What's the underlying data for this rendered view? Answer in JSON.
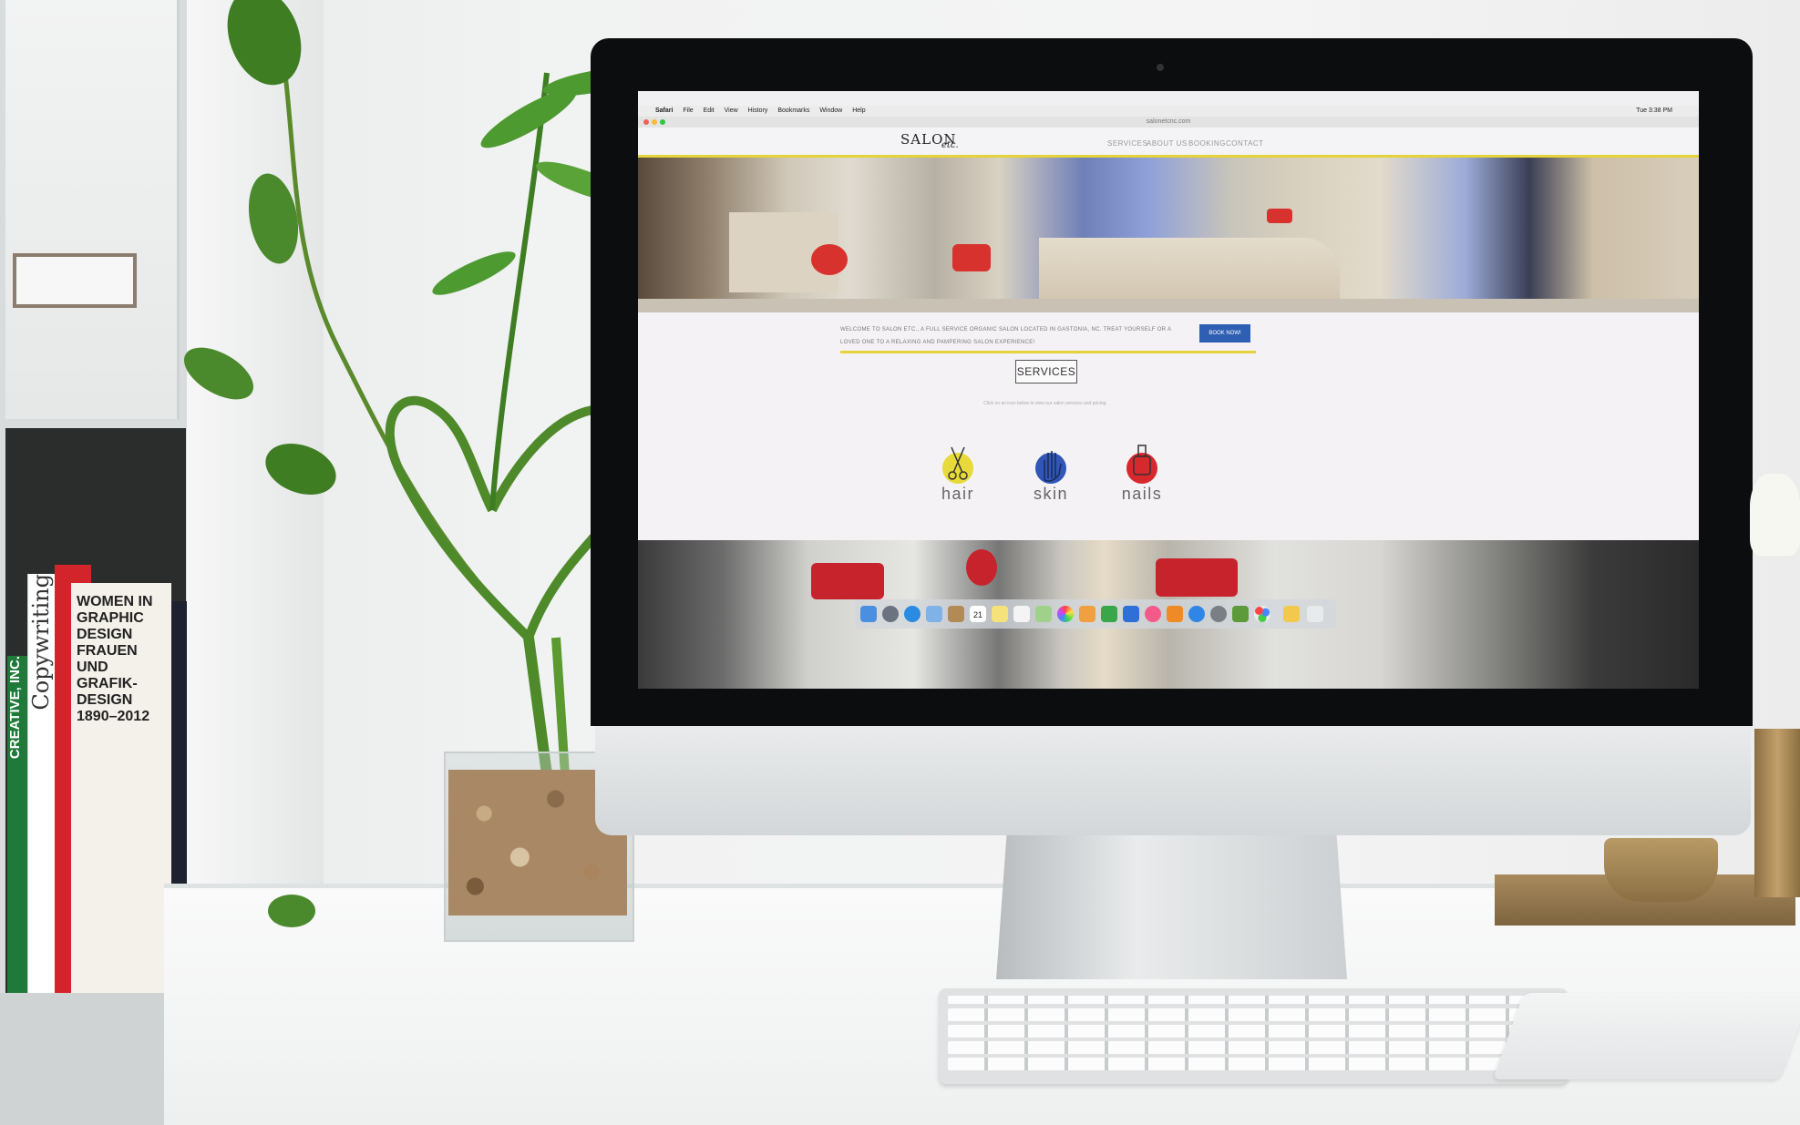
{
  "browser": {
    "menu": [
      "Safari",
      "File",
      "Edit",
      "View",
      "History",
      "Bookmarks",
      "Window",
      "Help"
    ],
    "url": "salonetcnc.com",
    "clock": "Tue 3:38 PM"
  },
  "site": {
    "logo": "SALON",
    "logo_suffix": "etc.",
    "nav": [
      "SERVICES",
      "ABOUT US",
      "BOOKING",
      "CONTACT"
    ],
    "welcome": "WELCOME TO SALON ETC., A FULL SERVICE ORGANIC SALON LOCATED IN GASTONIA, NC. TREAT YOURSELF OR A LOVED ONE TO A RELAXING AND PAMPERING SALON EXPERIENCE!",
    "book_button": "BOOK NOW!",
    "services_title": "SERVICES",
    "services_hint": "Click on an icon below to view our salon services and pricing.",
    "services": [
      {
        "label": "hair",
        "icon": "scissors-icon",
        "color": "#e7da3a"
      },
      {
        "label": "skin",
        "icon": "hand-icon",
        "color": "#3156b8"
      },
      {
        "label": "nails",
        "icon": "nail-polish-icon",
        "color": "#d7282d"
      }
    ]
  },
  "dock": {
    "calendar_day": "21",
    "icons": [
      "finder-icon",
      "launchpad-icon",
      "safari-icon",
      "mail-icon",
      "contacts-icon",
      "calendar-icon",
      "notes-icon",
      "reminders-icon",
      "maps-icon",
      "photos-icon",
      "pages-icon",
      "numbers-icon",
      "keynote-icon",
      "itunes-icon",
      "ibooks-icon",
      "app-store-icon",
      "system-preferences-icon",
      "minecraft-icon",
      "game-center-icon",
      "folder-icon",
      "trash-icon"
    ]
  },
  "books": [
    {
      "title": "CREATIVE, INC.",
      "color": "#1f7a3a"
    },
    {
      "title": "Copywriting",
      "color": "#ffffff"
    },
    {
      "title": "WOMEN IN GRAPHIC DESIGN FRAUEN UND GRAFIK-DESIGN 1890–2012",
      "color": "#f4f1ea"
    }
  ],
  "colors": {
    "accent_yellow": "#e4d33a",
    "button_blue": "#2f5fb3",
    "chair_red": "#c7232d"
  }
}
